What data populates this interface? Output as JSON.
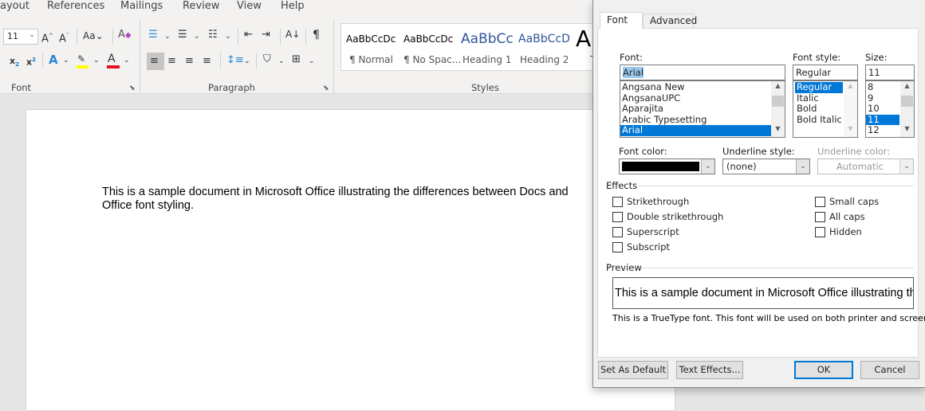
{
  "menu": [
    "ayout",
    "References",
    "Mailings",
    "Review",
    "View",
    "Help"
  ],
  "ribbon": {
    "font_size": "11",
    "groups": {
      "font": "Font",
      "paragraph": "Paragraph",
      "styles": "Styles"
    },
    "highlight_color": "#ffff00",
    "font_color": "#e81123",
    "styles": [
      {
        "sample": "AaBbCcDc",
        "name": "¶ Normal"
      },
      {
        "sample": "AaBbCcDc",
        "name": "¶ No Spac..."
      },
      {
        "sample": "AaBbCc",
        "name": "Heading 1"
      },
      {
        "sample": "AaBbCcD",
        "name": "Heading 2"
      },
      {
        "sample": "A",
        "name": "T"
      }
    ]
  },
  "document": {
    "text": "This is a sample document in Microsoft Office illustrating the differences between Docs and Office font styling."
  },
  "dialog": {
    "tabs": [
      {
        "label": "Font",
        "active": true
      },
      {
        "label": "Advanced",
        "active": false
      }
    ],
    "font_label": "Font:",
    "font_value": "Arial",
    "font_list": [
      "Angsana New",
      "AngsanaUPC",
      "Aparajita",
      "Arabic Typesetting",
      "Arial"
    ],
    "font_selected": "Arial",
    "style_label": "Font style:",
    "style_value": "Regular",
    "style_list": [
      "Regular",
      "Italic",
      "Bold",
      "Bold Italic"
    ],
    "style_selected": "Regular",
    "size_label": "Size:",
    "size_value": "11",
    "size_list": [
      "8",
      "9",
      "10",
      "11",
      "12"
    ],
    "size_selected": "11",
    "font_color_label": "Font color:",
    "font_color": "#000000",
    "underline_style_label": "Underline style:",
    "underline_style_value": "(none)",
    "underline_color_label": "Underline color:",
    "underline_color_value": "Automatic",
    "effects_label": "Effects",
    "effects_left": [
      {
        "label": "Strikethrough",
        "checked": false
      },
      {
        "label": "Double strikethrough",
        "checked": false
      },
      {
        "label": "Superscript",
        "checked": false
      },
      {
        "label": "Subscript",
        "checked": false
      }
    ],
    "effects_right": [
      {
        "label": "Small caps",
        "checked": false
      },
      {
        "label": "All caps",
        "checked": false
      },
      {
        "label": "Hidden",
        "checked": false
      }
    ],
    "preview_label": "Preview",
    "preview_text": "This is a sample document in Microsoft Office illustrating the differences",
    "note": "This is a TrueType font. This font will be used on both printer and screen.",
    "buttons": {
      "set_default": "Set As Default",
      "text_effects": "Text Effects...",
      "ok": "OK",
      "cancel": "Cancel"
    }
  }
}
